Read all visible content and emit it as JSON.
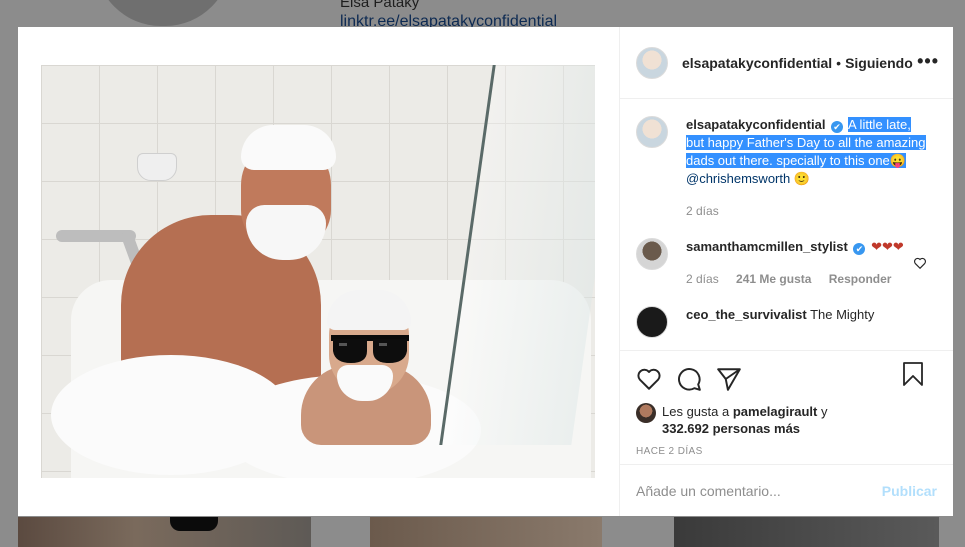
{
  "background": {
    "profile_name": "Elsa Pataky",
    "profile_link": "linktr.ee/elsapatakyconfidential"
  },
  "post": {
    "header": {
      "username": "elsapatakyconfidential",
      "separator": "•",
      "follow_state": "Siguiendo",
      "more_icon": "•••"
    },
    "caption": {
      "username": "elsapatakyconfidential",
      "verified_icon": "✔",
      "highlighted_text": "A little late, but happy Father's Day to all the amazing dads out there. specially to this one",
      "emoji": "😛",
      "mention": "@chrishemsworth",
      "trailing_emoji": "🙂",
      "time": "2 días"
    },
    "comments": [
      {
        "username": "samanthamcmillen_stylist",
        "verified_icon": "✔",
        "text": "❤❤❤",
        "time": "2 días",
        "likes": "241 Me gusta",
        "reply": "Responder"
      },
      {
        "username": "ceo_the_survivalist",
        "text": "The Mighty"
      }
    ],
    "likes": {
      "prefix": "Les gusta a",
      "user": "pamelagirault",
      "conjunction": "y",
      "count": "332.692 personas más"
    },
    "timestamp": "HACE 2 DÍAS",
    "comment_box": {
      "placeholder": "Añade un comentario...",
      "publish": "Publicar"
    }
  },
  "colors": {
    "highlight": "#3390ff",
    "verified": "#3897f0",
    "publish_disabled": "#b2dffc"
  }
}
